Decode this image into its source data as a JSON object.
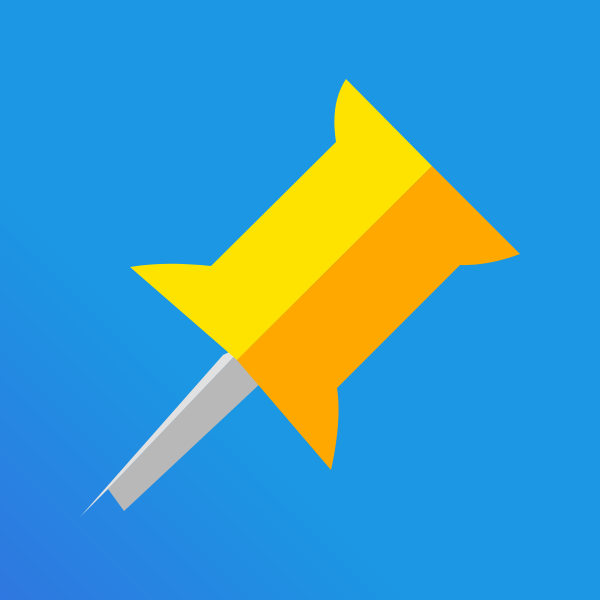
{
  "icon": {
    "name": "pushpin-icon",
    "colors": {
      "background_start": "#2f77e0",
      "background_end": "#1b97e3",
      "head_light": "#ffe300",
      "head_dark": "#ffa800",
      "needle_light": "#e1e1e1",
      "needle_dark": "#b8b8b8"
    }
  }
}
